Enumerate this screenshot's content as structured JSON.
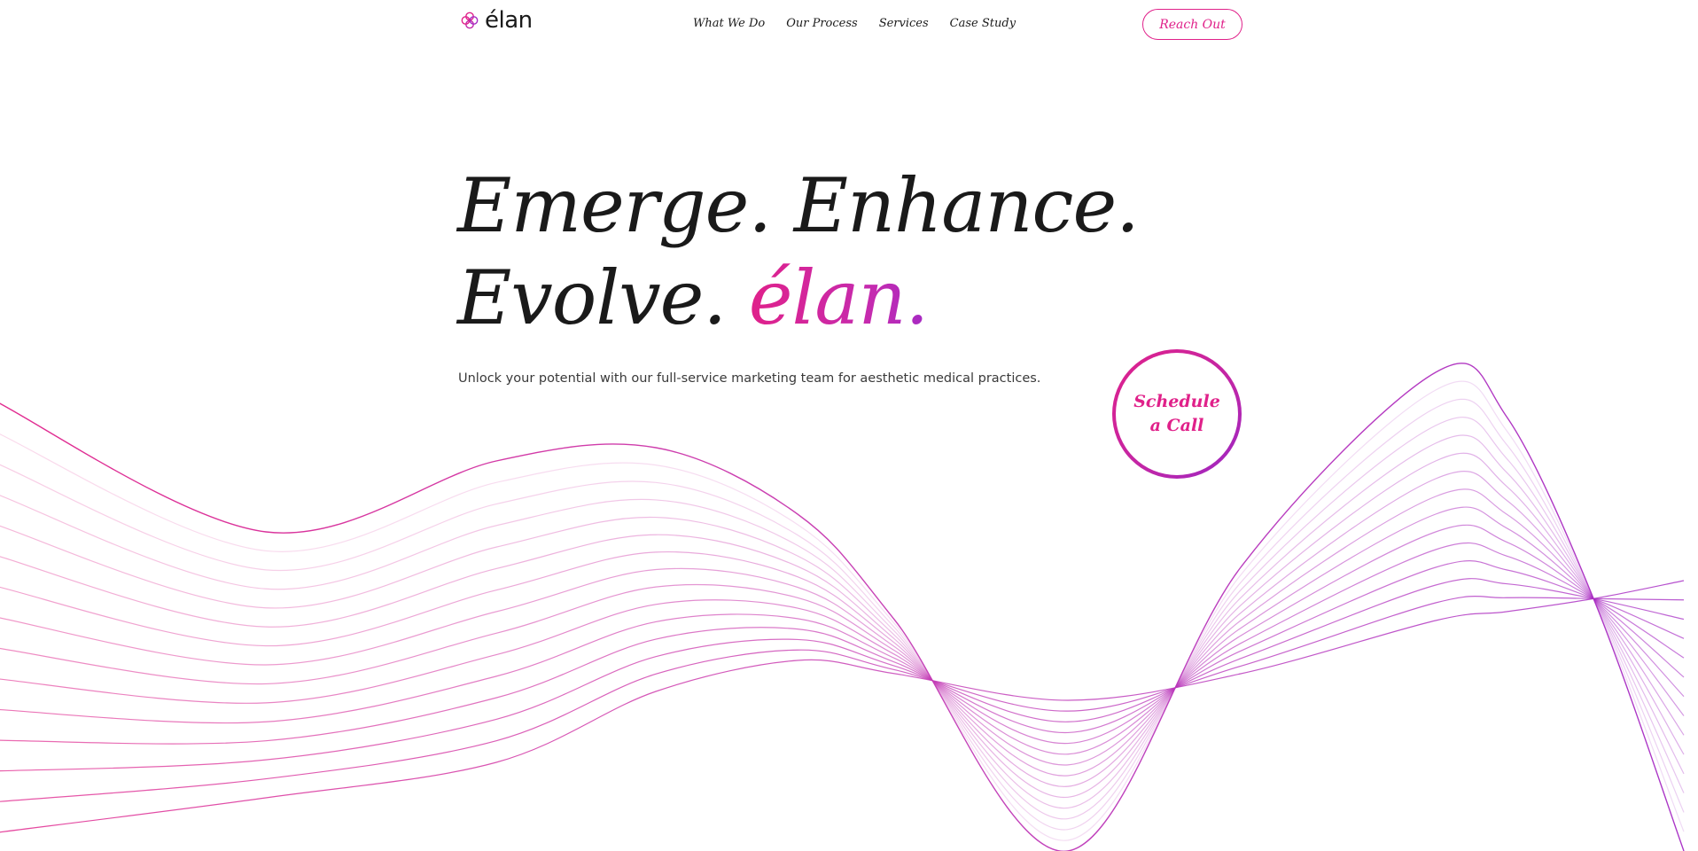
{
  "brand": {
    "name": "élan",
    "logo_icon": "flower-logo-icon"
  },
  "nav": {
    "items": [
      "What We Do",
      "Our Process",
      "Services",
      "Case Study"
    ]
  },
  "header": {
    "cta_label": "Reach Out"
  },
  "hero": {
    "title_line1": "Emerge. Enhance.",
    "title_line2_prefix": "Evolve.",
    "title_line2_brand": "élan.",
    "subtitle": "Unlock your potential with our full-service marketing team for aesthetic medical practices.",
    "schedule_label": "Schedule a Call"
  },
  "colors": {
    "accent": "#e0218a",
    "accent_purple": "#a52ac4",
    "text": "#1a1a1a",
    "background": "#ffffff"
  }
}
